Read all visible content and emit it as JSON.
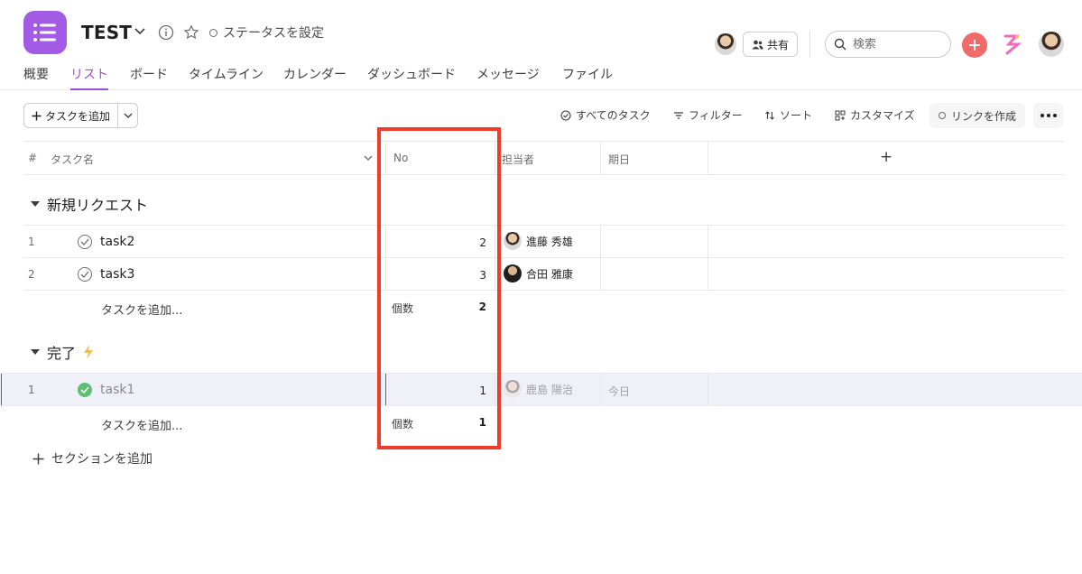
{
  "project": {
    "title": "TEST",
    "status_label": "ステータスを設定"
  },
  "header": {
    "share_label": "共有",
    "search_placeholder": "検索"
  },
  "tabs": [
    {
      "label": "概要"
    },
    {
      "label": "リスト"
    },
    {
      "label": "ボード"
    },
    {
      "label": "タイムライン"
    },
    {
      "label": "カレンダー"
    },
    {
      "label": "ダッシュボード"
    },
    {
      "label": "メッセージ"
    },
    {
      "label": "ファイル"
    }
  ],
  "toolbar": {
    "add_task": "タスクを追加",
    "all_tasks": "すべてのタスク",
    "filter": "フィルター",
    "sort": "ソート",
    "customize": "カスタマイズ",
    "create_link": "リンクを作成"
  },
  "columns": {
    "num": "#",
    "task_name": "タスク名",
    "no": "No",
    "assignee": "担当者",
    "due": "期日",
    "add": "+"
  },
  "sections": [
    {
      "title": "新規リクエスト",
      "rows": [
        {
          "num": "1",
          "name": "task2",
          "no": "2",
          "assignee": "進藤 秀雄",
          "due": ""
        },
        {
          "num": "2",
          "name": "task3",
          "no": "3",
          "assignee": "合田 雅康",
          "due": ""
        }
      ],
      "add_task": "タスクを追加...",
      "count_label": "個数",
      "count_value": "2"
    },
    {
      "title": "完了",
      "rows": [
        {
          "num": "1",
          "name": "task1",
          "no": "1",
          "assignee": "鹿島 陽治",
          "due": "今日"
        }
      ],
      "add_task": "タスクを追加...",
      "count_label": "個数",
      "count_value": "1"
    }
  ],
  "add_section": "セクションを追加",
  "colors": {
    "accent": "#9c4fd6",
    "app_icon": "#a35be6",
    "add_button": "#f06a6a",
    "done_check": "#5dbf74",
    "highlight_box": "#ee3b2a"
  }
}
